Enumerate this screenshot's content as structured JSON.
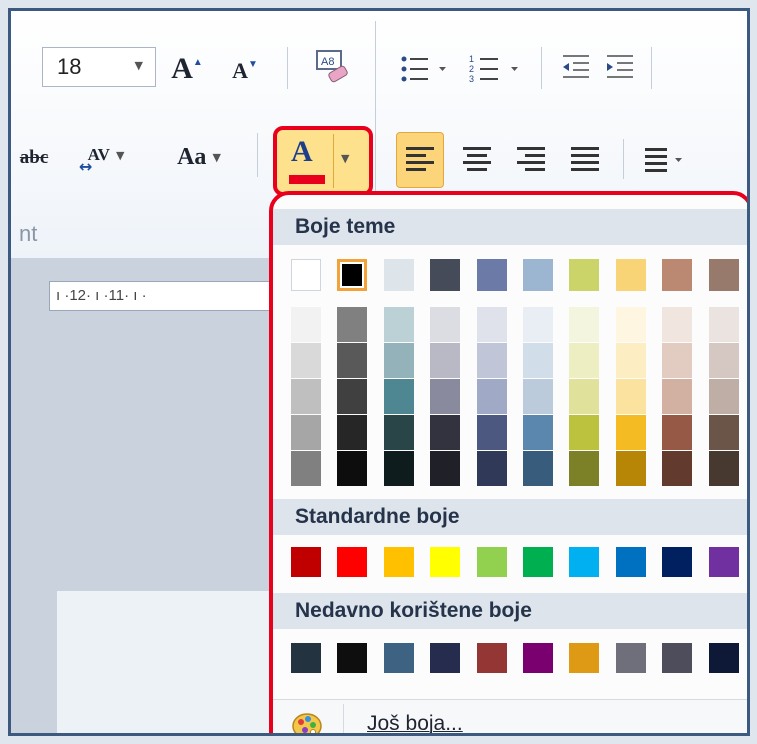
{
  "ribbon": {
    "font_size": "18",
    "grow_font_label": "A",
    "shrink_font_label": "A",
    "change_case_label": "Aa",
    "spacing_label": "AV",
    "strike_label": "abc",
    "font_color_label": "A",
    "font_group_label": "nt"
  },
  "ruler": {
    "text": "ı ·12· ı ·11· ı ·"
  },
  "color_panel": {
    "theme_title": "Boje teme",
    "standard_title": "Standardne boje",
    "recent_title": "Nedavno korištene boje",
    "more_colors_label": "Još boja...",
    "theme_colors": [
      "#FFFFFF",
      "#000000",
      "#DDE4EA",
      "#464B59",
      "#6B7AA6",
      "#9CB6D2",
      "#CBD468",
      "#F8D477",
      "#BB8872",
      "#977A6C"
    ],
    "theme_shades": [
      [
        "#F2F2F2",
        "#D9D9D9",
        "#BFBFBF",
        "#A6A6A6",
        "#808080"
      ],
      [
        "#808080",
        "#595959",
        "#404040",
        "#262626",
        "#0D0D0D"
      ],
      [
        "#BBD1D6",
        "#93B2B9",
        "#4E8791",
        "#294548",
        "#0E1C1E"
      ],
      [
        "#DCDCE3",
        "#B9B9C6",
        "#8A8A9E",
        "#32333F",
        "#1F2028"
      ],
      [
        "#DFE2EB",
        "#C0C6D8",
        "#A0A9C6",
        "#4D5880",
        "#303958"
      ],
      [
        "#E8EEF4",
        "#D1DEEA",
        "#BCCBDC",
        "#5B87AE",
        "#385C7B"
      ],
      [
        "#F4F5DF",
        "#EDEFC2",
        "#E0E29C",
        "#BCC23D",
        "#7C8027"
      ],
      [
        "#FEF6E0",
        "#FDEDC2",
        "#FBE29E",
        "#F4BB22",
        "#B88606"
      ],
      [
        "#F0E5DF",
        "#E2CCC2",
        "#D3B1A2",
        "#955945",
        "#633B2E"
      ],
      [
        "#EAE3E0",
        "#D5C8C2",
        "#BFAEA5",
        "#6B5448",
        "#473830"
      ]
    ],
    "standard_colors": [
      "#C00000",
      "#FF0000",
      "#FFC000",
      "#FFFF00",
      "#92D050",
      "#00B050",
      "#00B0F0",
      "#0070C0",
      "#002060",
      "#7030A0"
    ],
    "recent_colors": [
      "#243340",
      "#0E0E0E",
      "#3E6382",
      "#262C4D",
      "#943634",
      "#7A0070",
      "#DE9A15",
      "#6F6F7C",
      "#4D4D5C",
      "#0D1937"
    ]
  }
}
